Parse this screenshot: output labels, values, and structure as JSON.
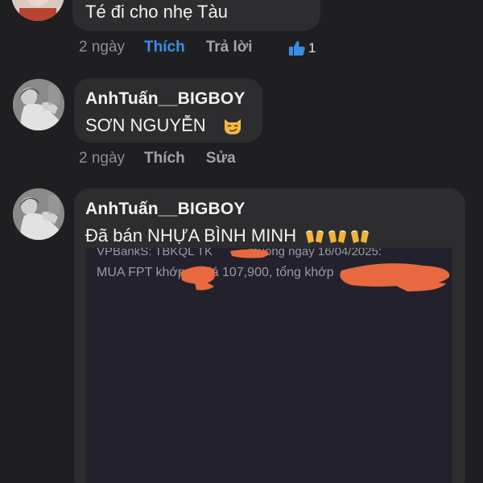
{
  "comments": [
    {
      "text": "Té đi cho nhẹ Tàu",
      "time": "2 ngày",
      "like_label": "Thích",
      "reply_label": "Trả lời",
      "like_count": "1"
    },
    {
      "author": "AnhTuấn__BIGBOY",
      "text": "SƠN NGUYỄN",
      "emoji": "smirking-cat",
      "time": "2 ngày",
      "like_label": "Thích",
      "edit_label": "Sửa"
    },
    {
      "author": "AnhTuấn__BIGBOY",
      "text": "Đã bán NHỰA BÌNH MINH",
      "emoji": "beer-mugs",
      "attachment": {
        "line1": "VPBankS: TBKQL TK",
        "line1_tail": "muong ngay 16/04/2025:",
        "line2": "MUA FPT khớp",
        "line2_mid": "giá 107,900, tổng khớp"
      }
    }
  ],
  "colors": {
    "background": "#1f1f21",
    "bubble": "#2d2d2f",
    "accent_blue": "#3b8de8",
    "redaction": "#e8693f"
  }
}
